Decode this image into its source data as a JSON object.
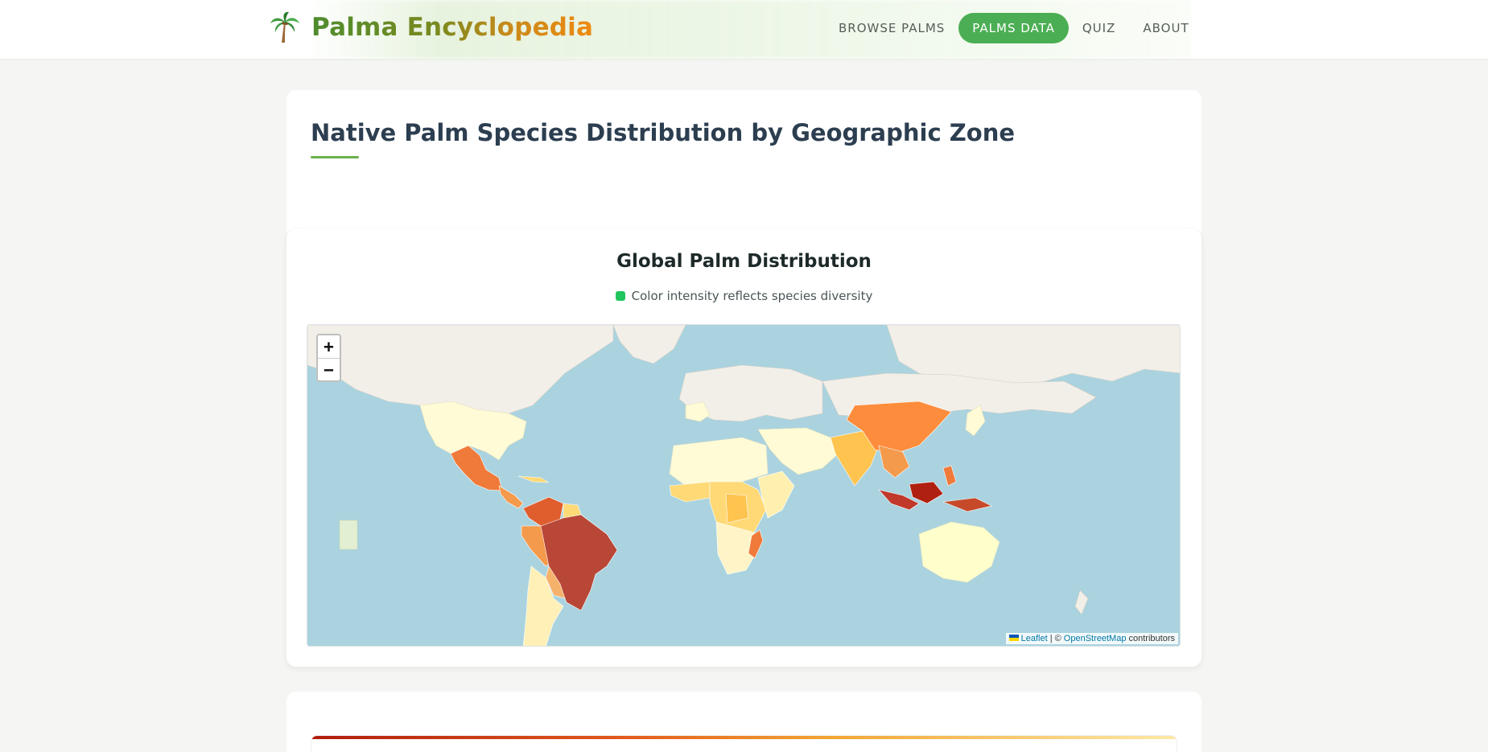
{
  "header": {
    "brand_name": "Palma Encyclopedia",
    "brand_icon": "palm-tree-icon",
    "nav": [
      {
        "label": "BROWSE PALMS",
        "active": false
      },
      {
        "label": "PALMS DATA",
        "active": true
      },
      {
        "label": "QUIZ",
        "active": false
      },
      {
        "label": "ABOUT",
        "active": false
      }
    ]
  },
  "page": {
    "title": "Native Palm Species Distribution by Geographic Zone"
  },
  "map_card": {
    "title": "Global Palm Distribution",
    "legend_text": "Color intensity reflects species diversity",
    "legend_color": "#22c55e",
    "zoom_in": "+",
    "zoom_out": "−",
    "attribution": {
      "leaflet": "Leaflet",
      "separator": "| ©",
      "osm": "OpenStreetMap",
      "suffix": "contributors"
    }
  },
  "colors": {
    "accent_green": "#4cae54",
    "ocean": "#aad3df",
    "land_base": "#f2efe9",
    "diversity_scale": [
      "#ffffcc",
      "#fff0b0",
      "#fed976",
      "#feb24c",
      "#fd8d3c",
      "#f07a3a",
      "#e05d2e",
      "#c0392b",
      "#b02010"
    ]
  }
}
